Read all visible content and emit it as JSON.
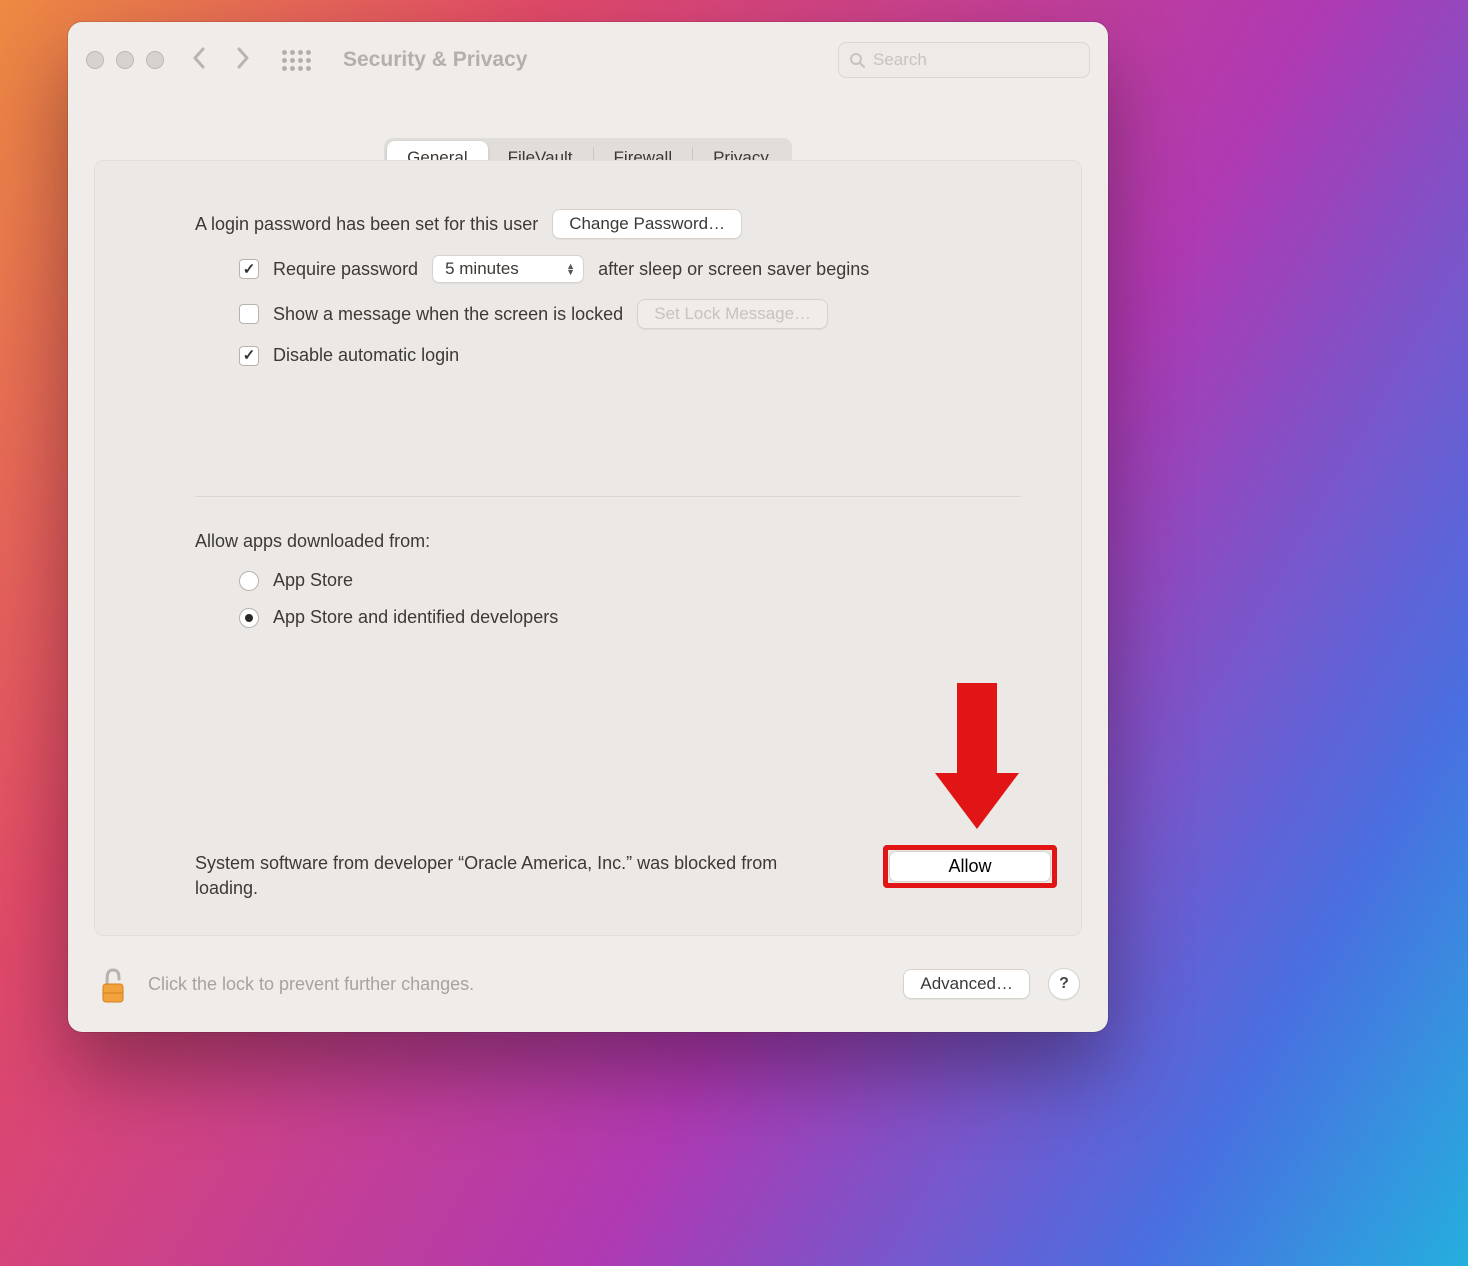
{
  "window": {
    "title": "Security & Privacy"
  },
  "search": {
    "placeholder": "Search"
  },
  "tabs": {
    "general": "General",
    "filevault": "FileVault",
    "firewall": "Firewall",
    "privacy": "Privacy",
    "active": "general"
  },
  "login": {
    "intro": "A login password has been set for this user",
    "change_password_btn": "Change Password…",
    "require_password_label": "Require password",
    "require_password_checked": true,
    "delay_selected": "5 minutes",
    "after_label": "after sleep or screen saver begins",
    "show_message_label": "Show a message when the screen is locked",
    "show_message_checked": false,
    "set_lock_message_btn": "Set Lock Message…",
    "disable_auto_login_label": "Disable automatic login",
    "disable_auto_login_checked": true
  },
  "gatekeeper": {
    "title": "Allow apps downloaded from:",
    "options": {
      "app_store": "App Store",
      "identified": "App Store and identified developers"
    },
    "selected": "identified"
  },
  "blocked": {
    "message": "System software from developer “Oracle America, Inc.” was blocked from loading.",
    "allow_btn": "Allow"
  },
  "footer": {
    "lock_text": "Click the lock to prevent further changes.",
    "advanced_btn": "Advanced…",
    "help_btn": "?"
  }
}
